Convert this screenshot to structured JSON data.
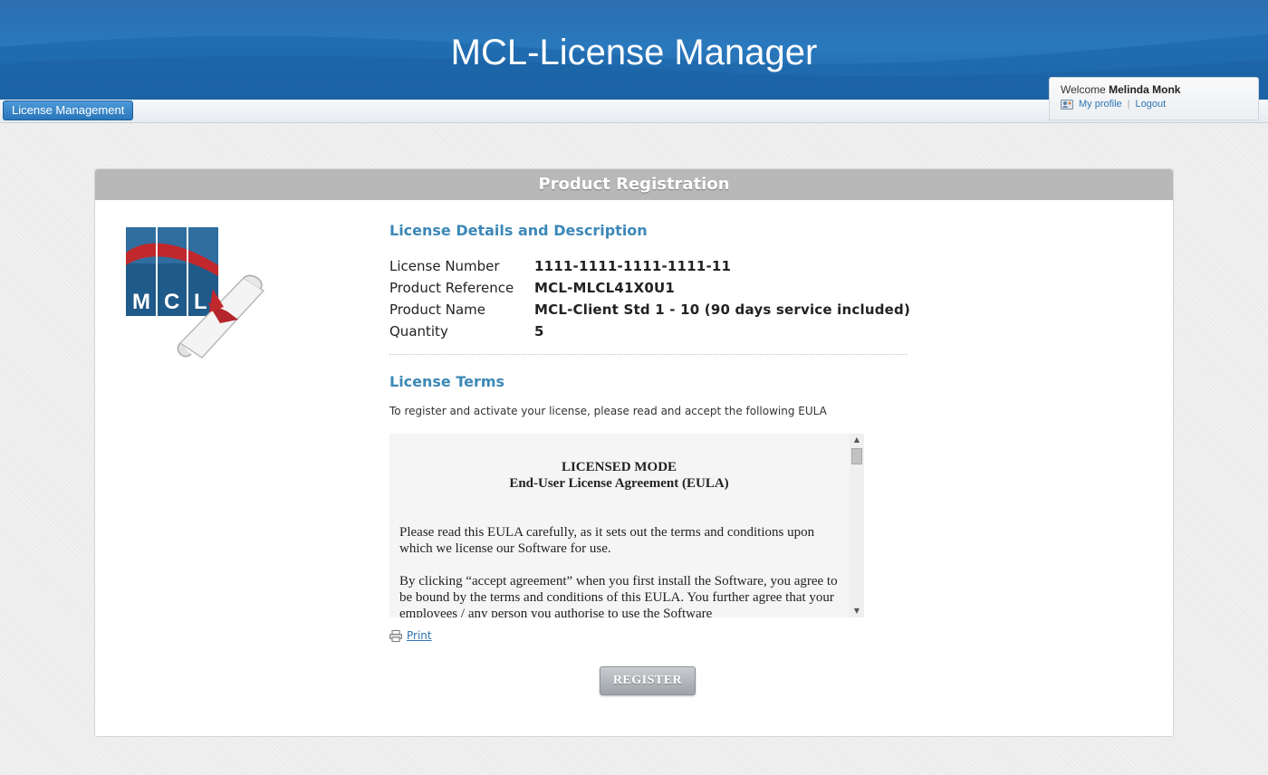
{
  "header": {
    "app_title": "MCL-License Manager",
    "nav_button": "License Management"
  },
  "user": {
    "welcome_prefix": "Welcome",
    "name": "Melinda Monk",
    "profile_link": "My profile",
    "logout_link": "Logout"
  },
  "panel": {
    "title": "Product Registration",
    "logo_text": [
      "M",
      "C",
      "L"
    ]
  },
  "license": {
    "section_title": "License Details and Description",
    "rows": [
      {
        "label": "License Number",
        "value": "1111-1111-1111-1111-11"
      },
      {
        "label": "Product Reference",
        "value": "MCL-MLCL41X0U1"
      },
      {
        "label": "Product Name",
        "value": "MCL-Client Std 1 - 10 (90 days service included)"
      },
      {
        "label": "Quantity",
        "value": "5"
      }
    ]
  },
  "terms": {
    "section_title": "License Terms",
    "intro": "To register and activate your license, please read and accept the following EULA",
    "eula_heading_1": "LICENSED MODE",
    "eula_heading_2": "End-User License Agreement (EULA)",
    "eula_paragraph_1": "Please read this EULA carefully, as it sets out the terms and conditions upon which we license our Software for use.",
    "eula_paragraph_2": "By clicking “accept agreement” when you first install the Software, you agree to be bound by the terms and conditions of this EULA. You further agree that your employees / any person you authorise to use the Software"
  },
  "actions": {
    "print_label": "Print",
    "register_label": "REGISTER"
  },
  "colors": {
    "banner_blue": "#2a78bd",
    "section_title": "#3c88b8",
    "logo_blue": "#1e5a8a",
    "logo_red": "#c0282d"
  }
}
